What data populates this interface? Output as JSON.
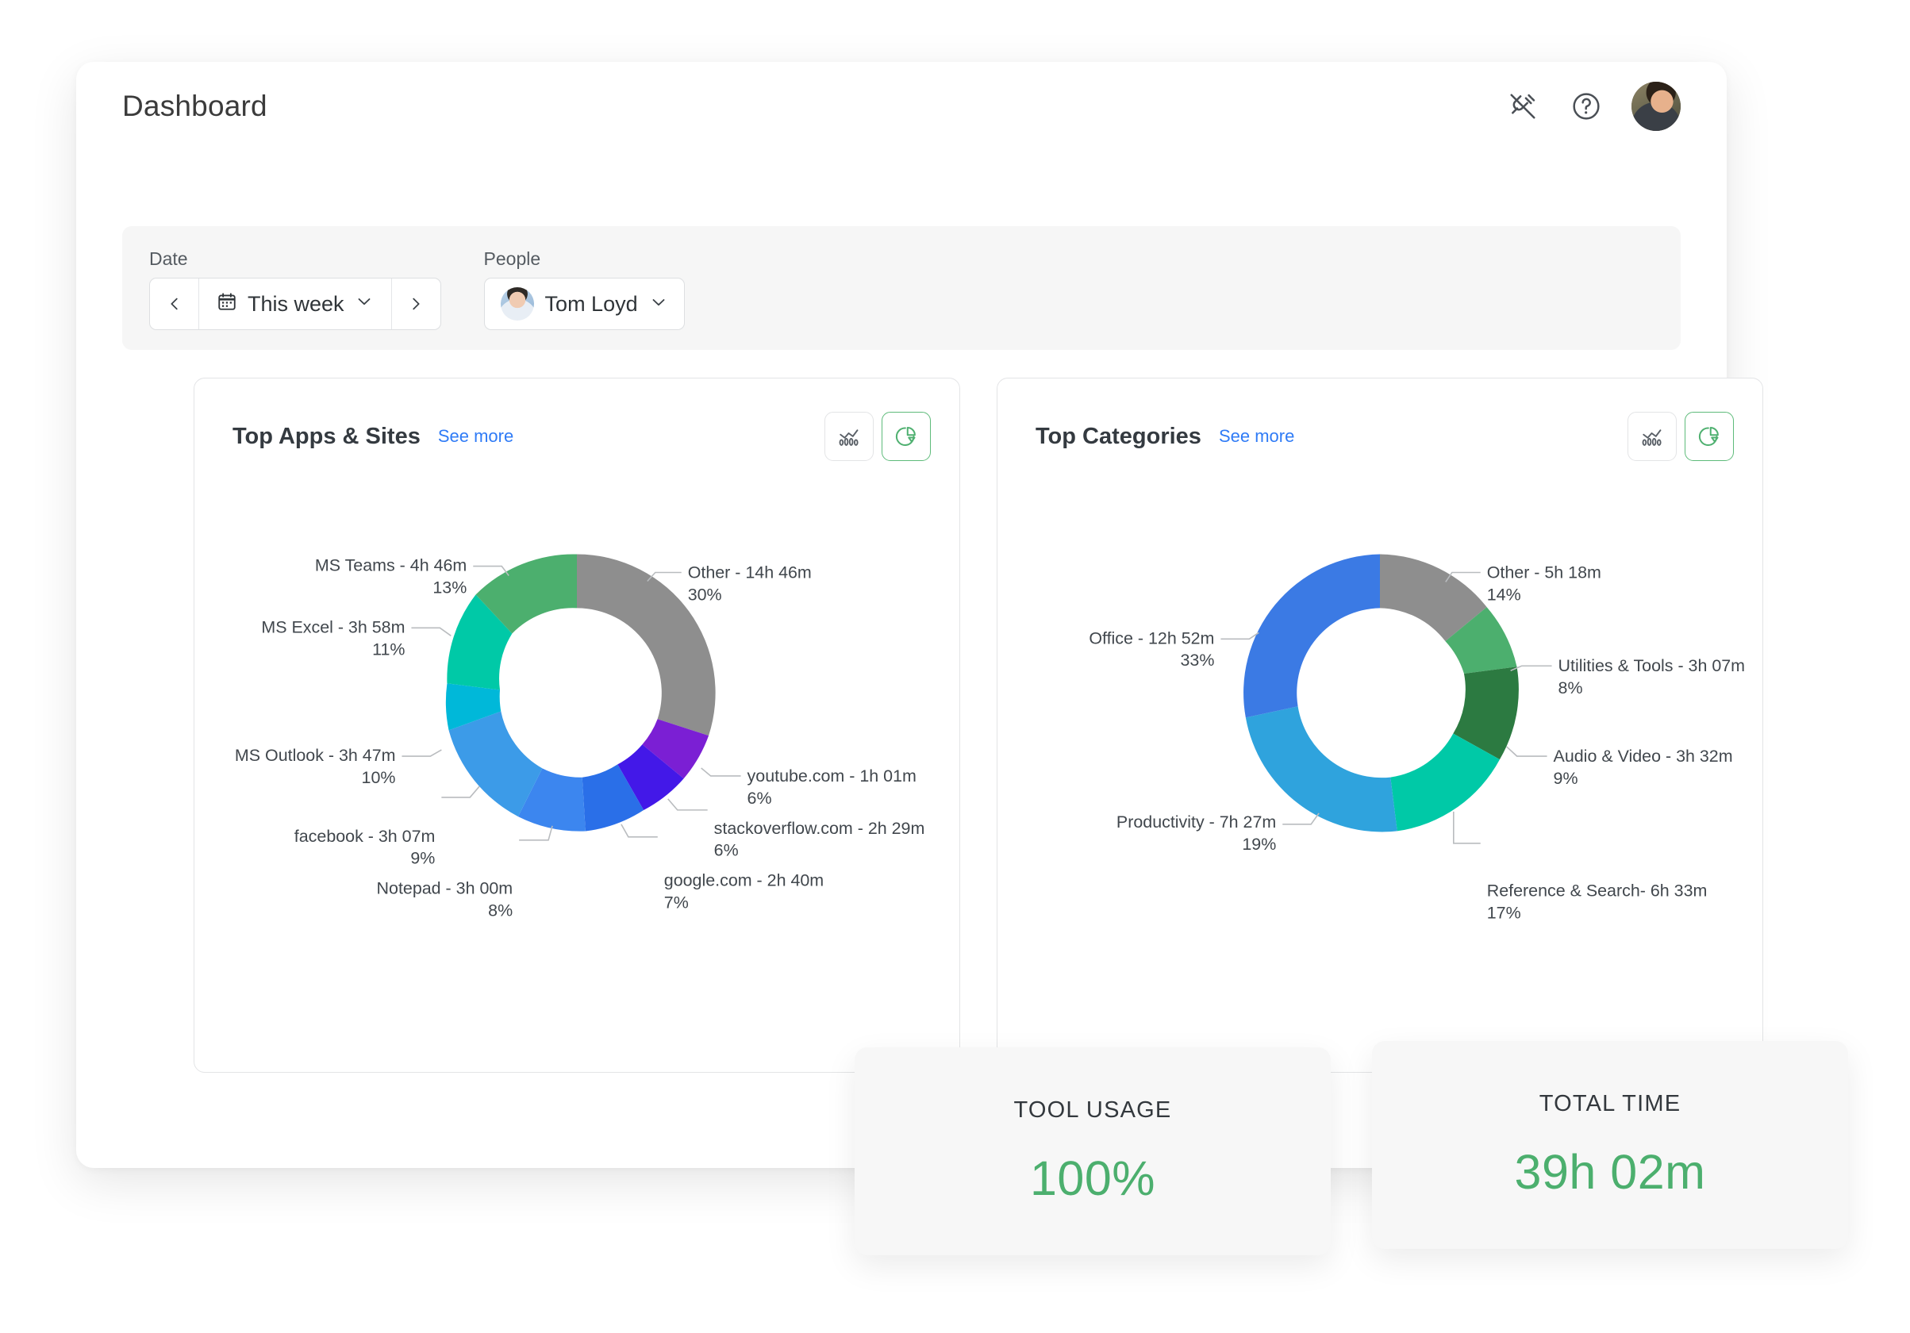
{
  "header": {
    "title": "Dashboard",
    "icons": [
      {
        "name": "plug-disconnected-icon"
      },
      {
        "name": "help-circle-icon"
      },
      {
        "name": "user-avatar"
      }
    ]
  },
  "filters": {
    "date": {
      "label": "Date",
      "value": "This week",
      "prev_icon": "chevron-left-icon",
      "next_icon": "chevron-right-icon",
      "calendar_icon": "calendar-icon",
      "caret_icon": "chevron-down-icon"
    },
    "people": {
      "label": "People",
      "value": "Tom Loyd",
      "caret_icon": "chevron-down-icon"
    }
  },
  "cards": {
    "apps": {
      "title": "Top Apps & Sites",
      "see_more": "See more",
      "toggle": {
        "line_label": "line-chart-view",
        "pie_label": "pie-chart-view",
        "active": "pie"
      }
    },
    "categories": {
      "title": "Top Categories",
      "see_more": "See more",
      "toggle": {
        "line_label": "line-chart-view",
        "pie_label": "pie-chart-view",
        "active": "pie"
      }
    }
  },
  "stats": [
    {
      "label": "TOOL USAGE",
      "value": "100%"
    },
    {
      "label": "TOTAL TIME",
      "value": "39h 02m"
    }
  ],
  "colors": {
    "accent_green": "#4caf6e",
    "link_blue": "#2f7bf6",
    "text_dark": "#343a40",
    "card_border": "#e3e4e6",
    "filter_bg": "#f6f6f6"
  },
  "chart_data": [
    {
      "type": "pie",
      "title": "Top Apps & Sites",
      "subtitle": "",
      "donut": true,
      "legend": "labels-with-leader-lines",
      "categories": [
        "Other",
        "youtube.com",
        "stackoverflow.com",
        "google.com",
        "Notepad",
        "facebook",
        "MS Outlook",
        "MS Excel",
        "MS Teams"
      ],
      "values": [
        30,
        6,
        6,
        7,
        8,
        9,
        10,
        11,
        13
      ],
      "durations": [
        "14h 46m",
        "1h 01m",
        "2h 29m",
        "2h 40m",
        "3h 00m",
        "3h 07m",
        "3h 47m",
        "3h 58m",
        "4h 46m"
      ],
      "labels": [
        "Other - 14h 46m",
        "youtube.com - 1h 01m",
        "stackoverflow.com - 2h 29m",
        "google.com - 2h 40m",
        "Notepad - 3h 00m",
        "facebook - 3h 07m",
        "MS Outlook - 3h 47m",
        "MS Excel - 3h 58m",
        "MS Teams - 4h 46m"
      ],
      "percent_labels": [
        "30%",
        "6%",
        "6%",
        "7%",
        "8%",
        "9%",
        "10%",
        "11%",
        "13%"
      ],
      "colors": [
        "#8e8e8e",
        "#7b1fd4",
        "#4318e8",
        "#2a6fe8",
        "#3c86ef",
        "#3c9be8",
        "#00b8d9",
        "#00c9a7",
        "#4caf6e"
      ]
    },
    {
      "type": "pie",
      "title": "Top Categories",
      "subtitle": "",
      "donut": true,
      "legend": "labels-with-leader-lines",
      "categories": [
        "Other",
        "Utilities & Tools",
        "Audio & Video",
        "Reference & Search",
        "Productivity",
        "Office"
      ],
      "values": [
        14,
        8,
        9,
        17,
        19,
        33
      ],
      "durations": [
        "5h 18m",
        "3h 07m",
        "3h 32m",
        "6h 33m",
        "7h 27m",
        "12h 52m"
      ],
      "labels": [
        "Other - 5h 18m",
        "Utilities & Tools - 3h 07m",
        "Audio & Video - 3h 32m",
        "Reference & Search- 6h 33m",
        "Productivity - 7h 27m",
        "Office - 12h 52m"
      ],
      "percent_labels": [
        "14%",
        "8%",
        "9%",
        "17%",
        "19%",
        "33%"
      ],
      "colors": [
        "#8e8e8e",
        "#4caf6e",
        "#2c7a41",
        "#00c9a7",
        "#2fa3dd",
        "#3b7ae4"
      ]
    }
  ]
}
